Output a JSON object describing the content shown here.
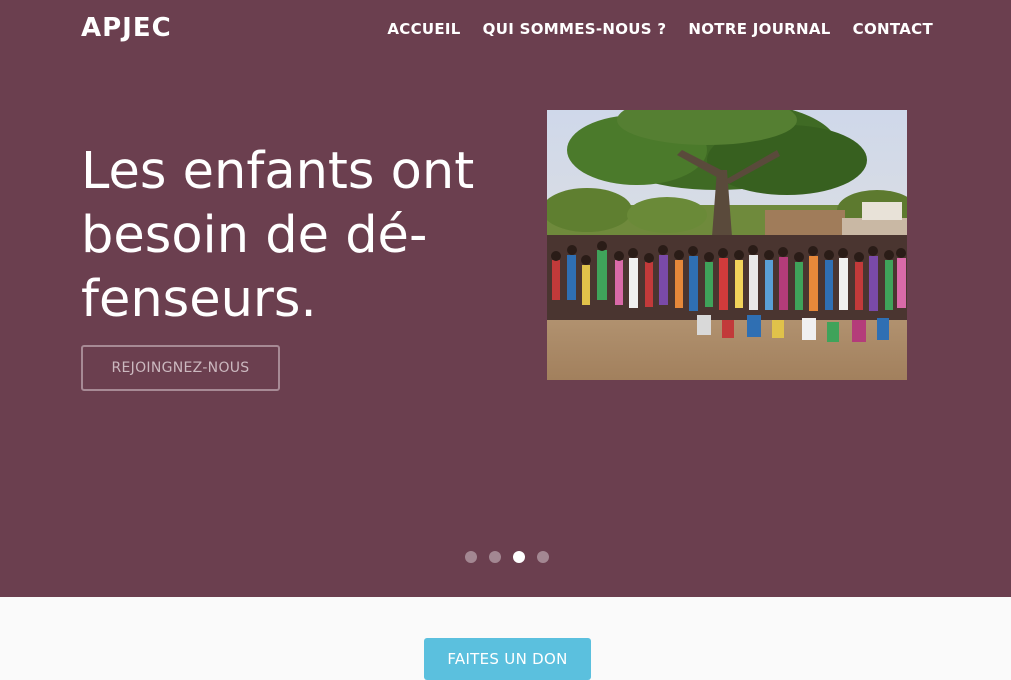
{
  "brand": {
    "name": "APJEC"
  },
  "nav": {
    "items": [
      {
        "label": "ACCUEIL"
      },
      {
        "label": "QUI SOMMES-NOUS ?"
      },
      {
        "label": "NOTRE JOURNAL"
      },
      {
        "label": "CONTACT"
      }
    ]
  },
  "hero": {
    "headline": "Les enfants ont besoin de dé-fenseurs.",
    "cta_label": "REJOINGNEZ-NOUS",
    "slider": {
      "count": 4,
      "active_index": 2
    }
  },
  "donate": {
    "label": "FAITES UN DON"
  },
  "colors": {
    "hero_bg": "#6b3f4f",
    "donate_button": "#5bc0de",
    "page_bg": "#fafafa"
  }
}
